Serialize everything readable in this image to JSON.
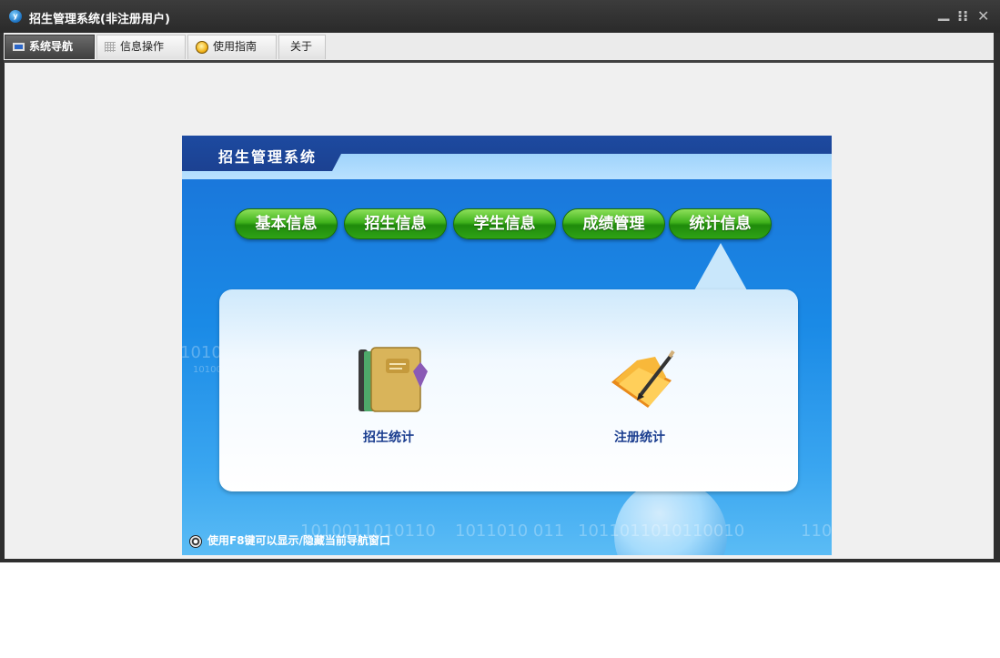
{
  "window": {
    "title": "招生管理系统(非注册用户)",
    "controls": {
      "minimize": "▁",
      "restore": "⁝⁝",
      "close": "✕"
    }
  },
  "tabs": [
    {
      "label": "系统导航",
      "icon": "monitor-icon",
      "active": true
    },
    {
      "label": "信息操作",
      "icon": "grid-icon",
      "active": false
    },
    {
      "label": "使用指南",
      "icon": "coin-icon",
      "active": false
    },
    {
      "label": "关于",
      "icon": "",
      "active": false
    }
  ],
  "panel": {
    "title": "招生管理系统",
    "nav_buttons": [
      "基本信息",
      "招生信息",
      "学生信息",
      "成绩管理",
      "统计信息"
    ],
    "selected_nav": "统计信息",
    "items": [
      {
        "label": "招生统计",
        "icon": "notebook-icon"
      },
      {
        "label": "注册统计",
        "icon": "folder-pencil-icon"
      }
    ],
    "footer_hint": "使用F8键可以显示/隐藏当前导航窗口",
    "decor_binary": [
      "1010011010110",
      "1011010  011",
      "1011011010110010",
      "110",
      "1010",
      "10100"
    ]
  },
  "colors": {
    "panel_blue": "#1a8ae6",
    "header_navy": "#1d4aa0",
    "button_green": "#3fb21c",
    "item_label": "#1a3d8f"
  }
}
